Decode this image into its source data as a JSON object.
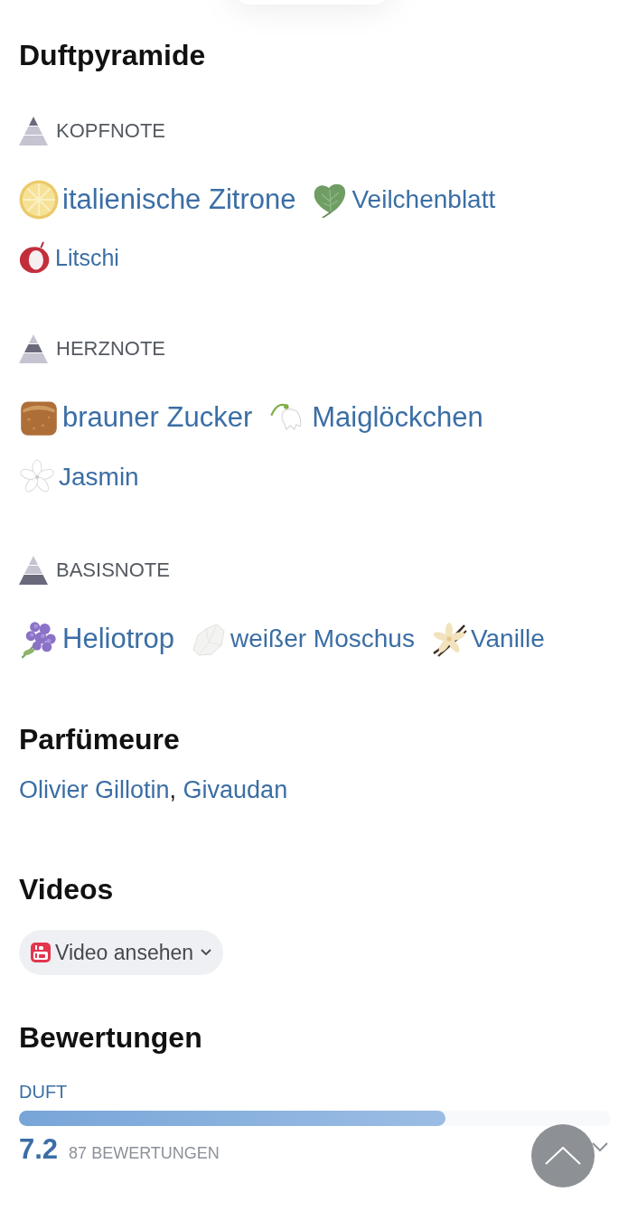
{
  "pyramid": {
    "title": "Duftpyramide",
    "levels": [
      {
        "kind": "top",
        "label": "KOPFNOTE",
        "notes": [
          {
            "kind": "strong",
            "name": "italienische Zitrone"
          },
          {
            "kind": "medium",
            "name": "Veilchenblatt"
          },
          {
            "kind": "weak",
            "name": "Litschi"
          }
        ]
      },
      {
        "kind": "heart",
        "label": "HERZNOTE",
        "notes": [
          {
            "kind": "strong",
            "name": "brauner Zucker"
          },
          {
            "kind": "strong",
            "name": "Maiglöckchen"
          },
          {
            "kind": "medium",
            "name": "Jasmin"
          }
        ]
      },
      {
        "kind": "base",
        "label": "BASISNOTE",
        "notes": [
          {
            "kind": "strong",
            "name": "Heliotrop"
          },
          {
            "kind": "medium",
            "name": "weißer Moschus"
          },
          {
            "kind": "medium",
            "name": "Vanille"
          }
        ]
      }
    ]
  },
  "perfumers": {
    "title": "Parfümeure",
    "names": [
      "Olivier Gillotin",
      "Givaudan"
    ],
    "separator": ","
  },
  "videos": {
    "title": "Videos",
    "button": "Video ansehen"
  },
  "ratings": {
    "title": "Bewertungen",
    "items": [
      {
        "label": "DUFT",
        "level": 0.72,
        "score": "7.2",
        "count": "87 BEWERTUNGEN"
      }
    ]
  }
}
